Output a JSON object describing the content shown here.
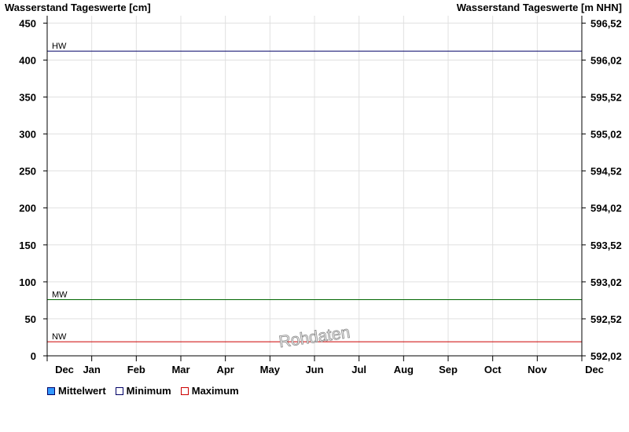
{
  "chart_data": {
    "type": "line",
    "y_title_left": "Wasserstand Tageswerte [cm]",
    "y_title_right": "Wasserstand Tageswerte [m NHN]",
    "x_tick_labels": [
      "Dec",
      "Jan",
      "Feb",
      "Mar",
      "Apr",
      "May",
      "Jun",
      "Jul",
      "Aug",
      "Sep",
      "Oct",
      "Nov",
      "Dec"
    ],
    "y_ticks_left": [
      0,
      50,
      100,
      150,
      200,
      250,
      300,
      350,
      400,
      450
    ],
    "y_ticks_right": [
      "592,02",
      "592,52",
      "593,02",
      "593,52",
      "594,02",
      "594,52",
      "595,02",
      "595,52",
      "596,02",
      "596,52"
    ],
    "ylim": [
      0,
      460
    ],
    "grid": true,
    "reference_lines": [
      {
        "label": "HW",
        "value": 412,
        "color": "#000066"
      },
      {
        "label": "MW",
        "value": 76,
        "color": "#006600"
      },
      {
        "label": "NW",
        "value": 19,
        "color": "#cc0000"
      }
    ],
    "series": [
      {
        "name": "Mittelwert",
        "color": "#3399ff",
        "values": []
      },
      {
        "name": "Minimum",
        "color": "#000066",
        "values": []
      },
      {
        "name": "Maximum",
        "color": "#cc0000",
        "values": []
      }
    ],
    "watermark": "Rohdaten"
  }
}
